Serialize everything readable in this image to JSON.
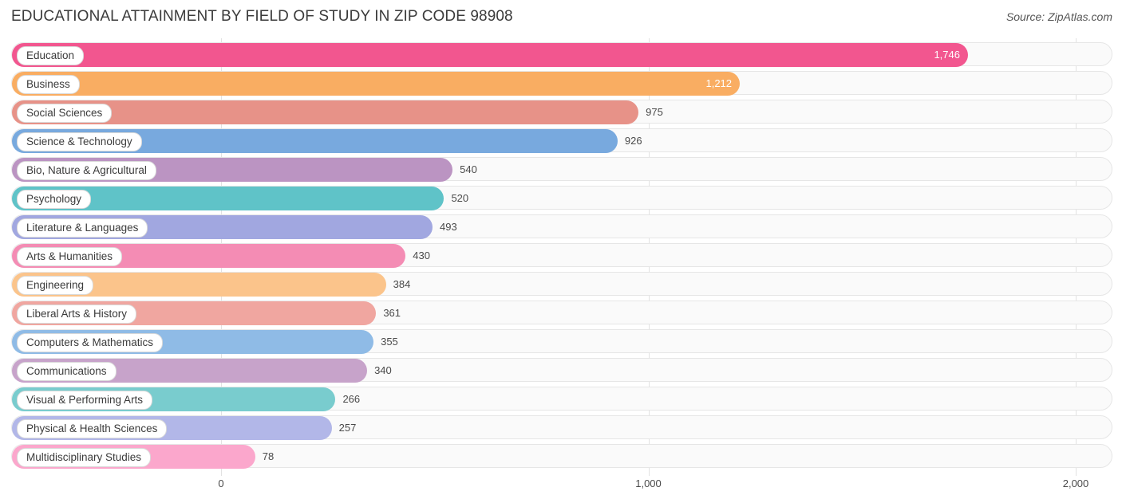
{
  "header": {
    "title": "EDUCATIONAL ATTAINMENT BY FIELD OF STUDY IN ZIP CODE 98908",
    "source": "Source: ZipAtlas.com"
  },
  "chart_data": {
    "type": "bar",
    "orientation": "horizontal",
    "title": "EDUCATIONAL ATTAINMENT BY FIELD OF STUDY IN ZIP CODE 98908",
    "xlabel": "",
    "ylabel": "",
    "xlim": [
      0,
      2000
    ],
    "grid": true,
    "legend": false,
    "xticks": [
      0,
      1000,
      2000
    ],
    "xtick_labels": [
      "0",
      "1,000",
      "2,000"
    ],
    "categories": [
      "Education",
      "Business",
      "Social Sciences",
      "Science & Technology",
      "Bio, Nature & Agricultural",
      "Psychology",
      "Literature & Languages",
      "Arts & Humanities",
      "Engineering",
      "Liberal Arts & History",
      "Computers & Mathematics",
      "Communications",
      "Visual & Performing Arts",
      "Physical & Health Sciences",
      "Multidisciplinary Studies"
    ],
    "values": [
      1746,
      1212,
      975,
      926,
      540,
      520,
      493,
      430,
      384,
      361,
      355,
      340,
      266,
      257,
      78
    ],
    "value_labels": [
      "1,746",
      "1,212",
      "975",
      "926",
      "540",
      "520",
      "493",
      "430",
      "384",
      "361",
      "355",
      "340",
      "266",
      "257",
      "78"
    ],
    "bar_colors": [
      "#f2568f",
      "#f9ad62",
      "#e79288",
      "#78a9de",
      "#bb94c2",
      "#5fc3c8",
      "#a1a7e0",
      "#f48cb4",
      "#fbc48b",
      "#f0a6a0",
      "#8fbbe6",
      "#c7a3ca",
      "#79ccce",
      "#b2b7e8",
      "#fba7cc"
    ]
  }
}
